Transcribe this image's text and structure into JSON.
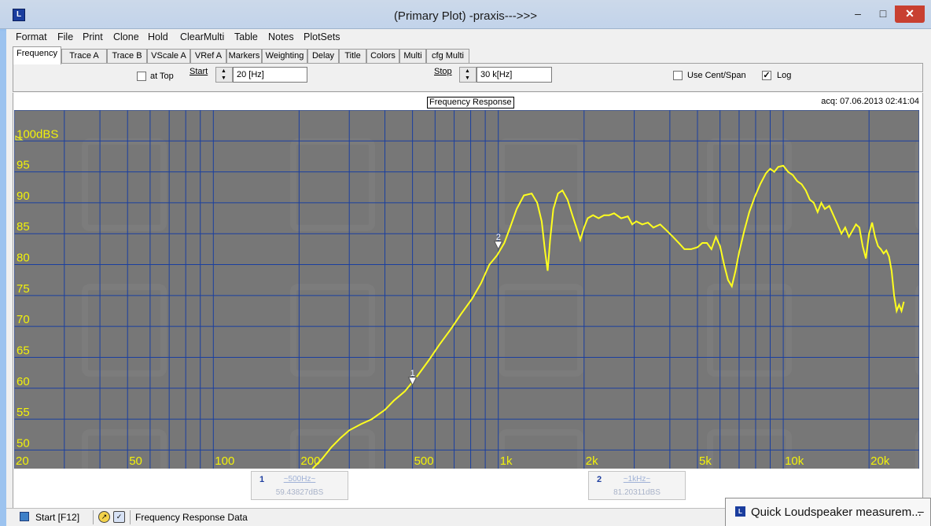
{
  "window": {
    "title": "(Primary Plot) -praxis--->>>",
    "minimize": "–",
    "maximize": "□",
    "close": "✕"
  },
  "menu": [
    "Format",
    "File",
    "Print",
    "Clone",
    "Hold",
    "ClearMulti",
    "Table",
    "Notes",
    "PlotSets"
  ],
  "tabs": [
    "Frequency",
    "Trace A",
    "Trace B",
    "VScale A",
    "VRef A",
    "Markers",
    "Weighting",
    "Delay",
    "Title",
    "Colors",
    "Multi",
    "cfg Multi"
  ],
  "active_tab": "Frequency",
  "controls": {
    "at_top_label": "at Top",
    "at_top_checked": false,
    "start_label": "Start",
    "start_value": "20 [Hz]",
    "stop_label": "Stop",
    "stop_value": "30 k[Hz]",
    "use_cent_span_label": "Use Cent/Span",
    "use_cent_span_checked": false,
    "log_label": "Log",
    "log_checked": true,
    "check_mark": "✓"
  },
  "plot": {
    "title": "Frequency Response",
    "acq": "acq: 07.06.2013 02:41:04"
  },
  "chart_data": {
    "type": "line",
    "title": "Frequency Response",
    "x_scale": "log",
    "xlim": [
      20,
      30000
    ],
    "ylim": [
      47,
      105
    ],
    "y_ticks": [
      {
        "v": 100,
        "label": "100dBS"
      },
      {
        "v": 95,
        "label": "95"
      },
      {
        "v": 90,
        "label": "90"
      },
      {
        "v": 85,
        "label": "85"
      },
      {
        "v": 80,
        "label": "80"
      },
      {
        "v": 75,
        "label": "75"
      },
      {
        "v": 70,
        "label": "70"
      },
      {
        "v": 65,
        "label": "65"
      },
      {
        "v": 60,
        "label": "60"
      },
      {
        "v": 55,
        "label": "55"
      },
      {
        "v": 50,
        "label": "50"
      }
    ],
    "x_ticks": [
      {
        "v": 20,
        "label": "20"
      },
      {
        "v": 50,
        "label": "50"
      },
      {
        "v": 100,
        "label": "100"
      },
      {
        "v": 200,
        "label": "200"
      },
      {
        "v": 500,
        "label": "500"
      },
      {
        "v": 1000,
        "label": "1k"
      },
      {
        "v": 2000,
        "label": "2k"
      },
      {
        "v": 5000,
        "label": "5k"
      },
      {
        "v": 10000,
        "label": "10k"
      },
      {
        "v": 20000,
        "label": "20k"
      }
    ],
    "grid": true,
    "colors": {
      "background": "#777777",
      "grid": "#1a3fa0",
      "trace": "#ffff1e",
      "label": "#f2f20a"
    },
    "series": [
      {
        "points": [
          [
            223,
            46
          ],
          [
            240,
            48.5
          ],
          [
            260,
            50.5
          ],
          [
            280,
            52
          ],
          [
            300,
            53.2
          ],
          [
            330,
            54.2
          ],
          [
            360,
            55
          ],
          [
            400,
            56.5
          ],
          [
            430,
            58
          ],
          [
            470,
            59.5
          ],
          [
            520,
            62
          ],
          [
            570,
            64.5
          ],
          [
            620,
            67
          ],
          [
            680,
            69.5
          ],
          [
            740,
            72
          ],
          [
            810,
            74.5
          ],
          [
            870,
            77
          ],
          [
            930,
            80
          ],
          [
            990,
            81.5
          ],
          [
            1050,
            83.5
          ],
          [
            1100,
            86
          ],
          [
            1160,
            89
          ],
          [
            1230,
            91.2
          ],
          [
            1310,
            91.5
          ],
          [
            1370,
            90
          ],
          [
            1420,
            87
          ],
          [
            1460,
            82
          ],
          [
            1490,
            79
          ],
          [
            1520,
            84
          ],
          [
            1560,
            89
          ],
          [
            1620,
            91.5
          ],
          [
            1680,
            92
          ],
          [
            1750,
            90.5
          ],
          [
            1820,
            88
          ],
          [
            1880,
            86
          ],
          [
            1940,
            84
          ],
          [
            2000,
            86
          ],
          [
            2060,
            87.5
          ],
          [
            2150,
            88
          ],
          [
            2250,
            87.5
          ],
          [
            2350,
            88
          ],
          [
            2450,
            88
          ],
          [
            2550,
            88.3
          ],
          [
            2700,
            87.5
          ],
          [
            2850,
            87.8
          ],
          [
            2950,
            86.5
          ],
          [
            3050,
            87
          ],
          [
            3200,
            86.5
          ],
          [
            3350,
            86.8
          ],
          [
            3500,
            86
          ],
          [
            3700,
            86.5
          ],
          [
            3900,
            85.5
          ],
          [
            4100,
            84.5
          ],
          [
            4300,
            83.5
          ],
          [
            4500,
            82.5
          ],
          [
            4750,
            82.5
          ],
          [
            5000,
            82.8
          ],
          [
            5200,
            83.5
          ],
          [
            5400,
            83.5
          ],
          [
            5600,
            82.5
          ],
          [
            5800,
            84.5
          ],
          [
            6000,
            83
          ],
          [
            6200,
            80
          ],
          [
            6400,
            77.5
          ],
          [
            6600,
            76.5
          ],
          [
            6800,
            79
          ],
          [
            7000,
            82
          ],
          [
            7300,
            85.5
          ],
          [
            7600,
            88.5
          ],
          [
            7950,
            91
          ],
          [
            8300,
            93
          ],
          [
            8700,
            94.8
          ],
          [
            9000,
            95.5
          ],
          [
            9300,
            95
          ],
          [
            9600,
            95.8
          ],
          [
            10000,
            96
          ],
          [
            10400,
            95
          ],
          [
            10800,
            94.5
          ],
          [
            11200,
            93.5
          ],
          [
            11600,
            93
          ],
          [
            12000,
            92
          ],
          [
            12400,
            90.5
          ],
          [
            12800,
            90
          ],
          [
            13200,
            88.5
          ],
          [
            13600,
            90
          ],
          [
            14000,
            89
          ],
          [
            14500,
            89.5
          ],
          [
            15000,
            88
          ],
          [
            15500,
            86.5
          ],
          [
            16000,
            85
          ],
          [
            16500,
            86
          ],
          [
            17000,
            84.5
          ],
          [
            17500,
            85.5
          ],
          [
            18000,
            86.5
          ],
          [
            18500,
            86
          ],
          [
            19000,
            83
          ],
          [
            19500,
            81
          ],
          [
            20000,
            85
          ],
          [
            20500,
            86.8
          ],
          [
            21000,
            84.5
          ],
          [
            21500,
            83
          ],
          [
            22000,
            82.5
          ],
          [
            22500,
            81.8
          ],
          [
            23000,
            82.3
          ],
          [
            23500,
            81.3
          ],
          [
            24000,
            79
          ],
          [
            24500,
            75
          ],
          [
            25000,
            72.5
          ],
          [
            25500,
            73.5
          ],
          [
            26000,
            72.5
          ],
          [
            26500,
            74
          ]
        ]
      }
    ],
    "markers": [
      {
        "label": "1",
        "freq": 500,
        "db": 60.5
      },
      {
        "label": "2",
        "freq": 1000,
        "db": 82.5
      }
    ]
  },
  "marker_boxes": [
    {
      "num": "1",
      "name": "~500Hz~",
      "value": "59.43827dBS"
    },
    {
      "num": "2",
      "name": "~1kHz~",
      "value": "81.20311dBS"
    }
  ],
  "status": {
    "start": "Start [F12]",
    "text": "Frequency Response Data"
  },
  "taskbar_popup": {
    "title": "Quick Loudspeaker measurem...",
    "minimize": "–"
  }
}
